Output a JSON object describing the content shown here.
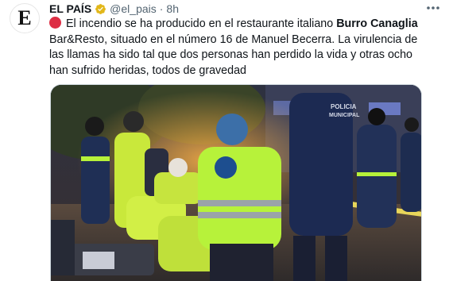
{
  "account": {
    "avatar_letter": "E",
    "display_name": "EL PAÍS",
    "verified_badge": "verified-badge-icon",
    "handle": "@el_pais",
    "separator": "·",
    "time": "8h",
    "more_icon": "more-options-icon"
  },
  "tweet": {
    "emoji": "red-circle",
    "text_before": "El incendio se ha producido en el restaurante italiano ",
    "bold_text": "Burro Canaglia",
    "text_after": " Bar&Resto, situado en el número 16 de Manuel Becerra. La virulencia de las llamas ha sido tal que dos personas han perdido la vida y otras ocho han sufrido heridas, todos de gravedad"
  },
  "media": {
    "police_label_line1": "POLICIA",
    "police_label_line2": "MUNICIPAL"
  },
  "colors": {
    "verified_badge": "#e2b719",
    "emoji_red": "#dd2e44",
    "hi_vis": "#b7f23a"
  }
}
